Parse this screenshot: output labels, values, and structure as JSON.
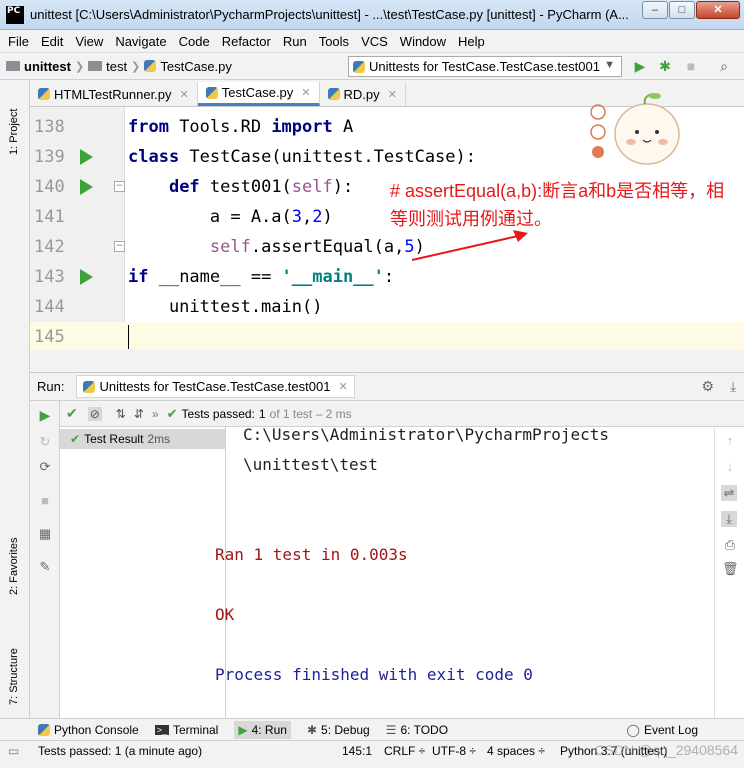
{
  "window": {
    "app_logo": "PC",
    "title": "unittest [C:\\Users\\Administrator\\PycharmProjects\\unittest] - ...\\test\\TestCase.py [unittest] - PyCharm (A...",
    "buttons": {
      "minimize": "–",
      "maximize": "□",
      "close": "✕"
    }
  },
  "menu": [
    "File",
    "Edit",
    "View",
    "Navigate",
    "Code",
    "Refactor",
    "Run",
    "Tools",
    "VCS",
    "Window",
    "Help"
  ],
  "nav": {
    "crumbs": [
      "unittest",
      "test",
      "TestCase.py"
    ],
    "run_config": "Unittests for TestCase.TestCase.test001"
  },
  "left_tool_tabs": {
    "project": "1: Project",
    "favorites": "2: Favorites",
    "structure": "7: Structure"
  },
  "editor_tabs": [
    {
      "label": "HTMLTestRunner.py",
      "active": false
    },
    {
      "label": "TestCase.py",
      "active": true
    },
    {
      "label": "RD.py",
      "active": false
    }
  ],
  "editor": {
    "line_numbers": [
      "138",
      "139",
      "140",
      "141",
      "142",
      "143",
      "144",
      "145"
    ],
    "lines": {
      "l138": {
        "kw1": "from",
        "mid": " Tools.RD ",
        "kw2": "import",
        "end": " A"
      },
      "l139": {
        "kw": "class",
        "rest": " TestCase(unittest.TestCase):"
      },
      "l140": {
        "indent": "    ",
        "kw": "def",
        "name": " test001(",
        "self": "self",
        "end": "):"
      },
      "l141": {
        "pre": "        a = A.a(",
        "n1": "3",
        "comma": ",",
        "n2": "2",
        "end": ")"
      },
      "l142": {
        "indent": "        ",
        "self": "self",
        "mid": ".assertEqual(a,",
        "n": "5",
        "end": ")"
      },
      "l143": {
        "kw": "if",
        "mid": " __name__ == ",
        "str": "'__main__'",
        "end": ":"
      },
      "l144": {
        "code": "    unittest.main()"
      }
    },
    "annotation": "# assertEqual(a,b):断言a和b是否相等，相等则测试用例通过。"
  },
  "run_panel": {
    "label": "Run:",
    "tab": "Unittests for TestCase.TestCase.test001",
    "tests_passed_label": "Tests passed:",
    "tests_passed_count": "1",
    "tests_passed_detail": "of 1 test – 2 ms",
    "tree_item": "Test Result",
    "tree_time": "2ms",
    "console": [
      "C:\\Users\\Administrator\\PycharmProjects",
      "\\unittest\\test",
      "Ran 1 test in 0.003s",
      "OK",
      "Process finished with exit code 0"
    ]
  },
  "bottom_tabs": [
    {
      "label": "Python Console",
      "icon": "python-icon"
    },
    {
      "label": "Terminal",
      "icon": "terminal-icon"
    },
    {
      "label": "4: Run",
      "icon": "run-icon"
    },
    {
      "label": "5: Debug",
      "icon": "debug-icon"
    },
    {
      "label": "6: TODO",
      "icon": "todo-icon"
    }
  ],
  "event_log": "Event Log",
  "status": {
    "message": "Tests passed: 1 (a minute ago)",
    "position": "145:1",
    "line_sep": "CRLF ÷",
    "encoding": "UTF-8 ÷",
    "indent": "4 spaces ÷",
    "interpreter": "Python 3.7 (unittest)",
    "watermark": "CSDN @qq_29408564"
  },
  "colors": {
    "accent": "#4083c9",
    "run_green": "#3fa33d",
    "annotation_red": "#e81818",
    "console_red": "#a31515",
    "console_blue": "#1f1f99"
  }
}
